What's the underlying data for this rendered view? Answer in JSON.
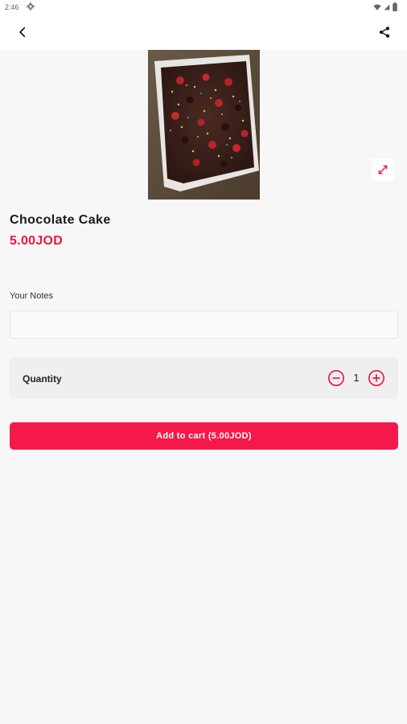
{
  "status_bar": {
    "time": "2:46",
    "icons": [
      "settings-gear-icon",
      "wifi-icon",
      "signal-icon",
      "battery-icon"
    ]
  },
  "topbar": {
    "back_icon": "chevron-left-icon",
    "share_icon": "share-icon"
  },
  "product": {
    "name": "Chocolate Cake",
    "price": "5.00JOD",
    "image_alt_icon": "product-photo",
    "expand_icon": "expand-arrows-icon"
  },
  "notes": {
    "label": "Your Notes",
    "value": "",
    "placeholder": ""
  },
  "quantity": {
    "label": "Quantity",
    "value": "1",
    "minus_icon": "minus-circle-icon",
    "plus_icon": "plus-circle-icon"
  },
  "cart": {
    "add_label": "Add to cart (5.00JOD)"
  },
  "colors": {
    "accent": "#f5184a",
    "price": "#f0163e",
    "background": "#f7f7f7",
    "quantity_bg": "#efeff1"
  }
}
